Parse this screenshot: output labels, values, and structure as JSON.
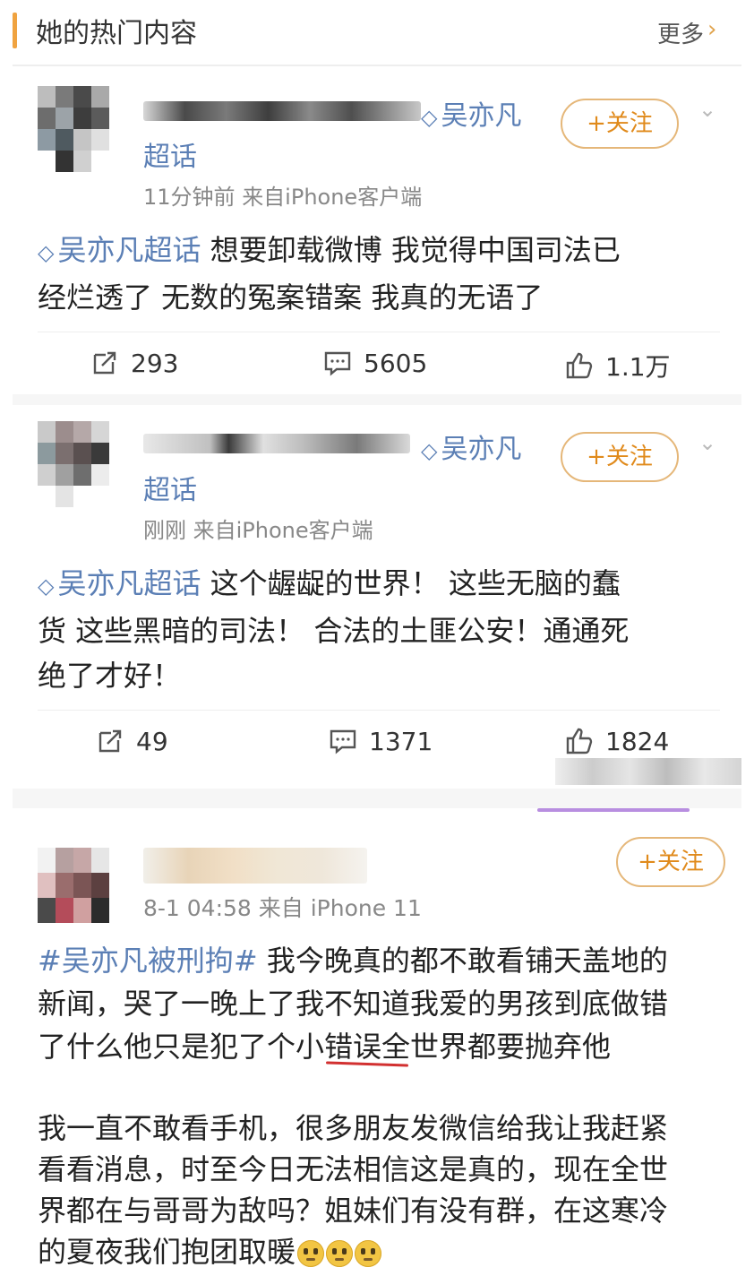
{
  "header": {
    "title": "她的热门内容",
    "more": "更多",
    "chevron": "›"
  },
  "posts": [
    {
      "topic": "吴亦凡",
      "topic_line2": "超话",
      "meta_time": "11分钟前",
      "meta_source": "来自iPhone客户端",
      "follow": "+关注",
      "body_tag": "吴亦凡超话",
      "body_line1": " 想要卸载微博 我觉得中国司法已",
      "body_line2": "经烂透了 无数的冤案错案  我真的无语了",
      "stats": {
        "reposts": "293",
        "comments": "5605",
        "likes": "1.1万"
      }
    },
    {
      "topic": "吴亦凡",
      "topic_line2": "超话",
      "meta_time": "刚刚",
      "meta_source": "来自iPhone客户端",
      "follow": "+关注",
      "body_tag": "吴亦凡超话",
      "body_line1": " 这个龌龊的世界！ 这些无脑的蠢",
      "body_line2": "货 这些黑暗的司法！ 合法的土匪公安！通通死",
      "body_line3": "绝了才好！",
      "stats": {
        "reposts": "49",
        "comments": "1371",
        "likes": "1824"
      }
    },
    {
      "meta": "8-1 04:58  来自 iPhone 11",
      "follow": "+关注",
      "tag": "#吴亦凡被刑拘#",
      "para1_line1": " 我今晚真的都不敢看铺天盖地的",
      "para1_line2": "新闻，哭了一晚上了我不知道我爱的男孩到底做错",
      "para1_line3": "了什么他只是犯了个小错误全世界都要抛弃他",
      "para2_line1": "我一直不敢看手机，很多朋友发微信给我让我赶紧",
      "para2_line2": "看看消息，时至今日无法相信这是真的，现在全世",
      "para2_line3": "界都在与哥哥为敌吗？姐妹们有没有群，在这寒冷",
      "para2_line4": "的夏夜我们抱团取暖"
    }
  ],
  "colors": {
    "accent_orange": "#f0a340",
    "topic_blue": "#5b7fb5",
    "underline_red": "#d23030"
  }
}
